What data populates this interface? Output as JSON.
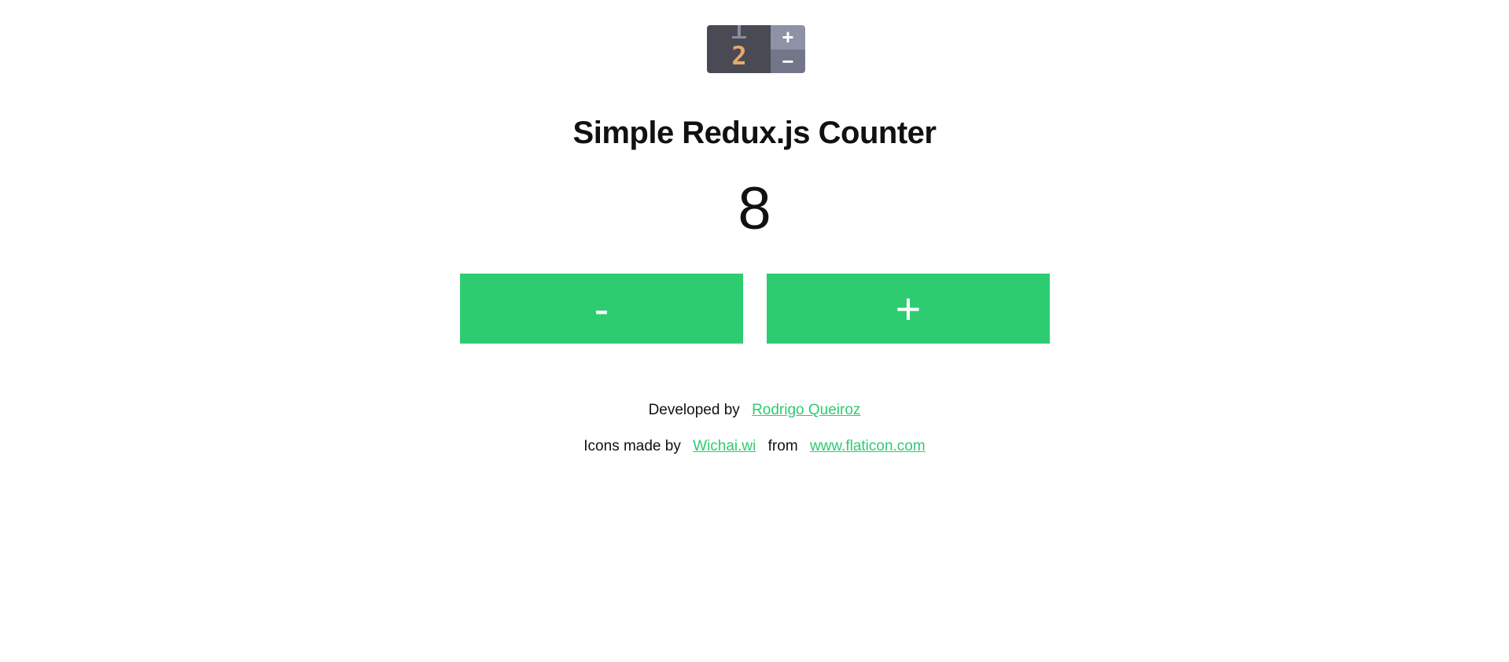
{
  "logo": {
    "digit": "2",
    "plus_symbol": "+",
    "minus_symbol": "−",
    "colors": {
      "dark": "#4a4a55",
      "digit": "#e6a96a",
      "panel_top": "#8f92a6",
      "panel_bottom": "#737689"
    }
  },
  "title": "Simple Redux.js Counter",
  "counter": {
    "value": "8"
  },
  "buttons": {
    "decrement_label": "-",
    "increment_label": "+",
    "color": "#2ecc71"
  },
  "credits": {
    "developed_prefix": "Developed by",
    "developer_name": "Rodrigo Queiroz",
    "icons_prefix": "Icons made by",
    "icons_author": "Wichai.wi",
    "from_text": "from",
    "icons_site": "www.flaticon.com",
    "link_color": "#2ecc71"
  }
}
